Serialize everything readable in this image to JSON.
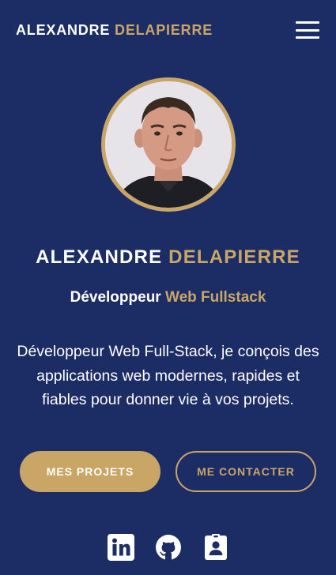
{
  "header": {
    "brand_first": "ALEXANDRE",
    "brand_last": "DELAPIERRE",
    "menu_icon": "hamburger-menu-icon"
  },
  "hero": {
    "name_first": "ALEXANDRE",
    "name_last": "DELAPIERRE",
    "role_prefix": "Développeur",
    "role_highlight": "Web Fullstack",
    "description": "Développeur Web Full-Stack, je conçois des applications web modernes, rapides et fiables pour donner vie à vos projets."
  },
  "buttons": {
    "projects_label": "MES PROJETS",
    "contact_label": "ME CONTACTER"
  },
  "socials": [
    {
      "icon": "linkedin-icon"
    },
    {
      "icon": "github-icon"
    },
    {
      "icon": "contact-card-icon"
    }
  ],
  "colors": {
    "background": "#1c2d66",
    "accent": "#c9a566",
    "text": "#ffffff"
  }
}
